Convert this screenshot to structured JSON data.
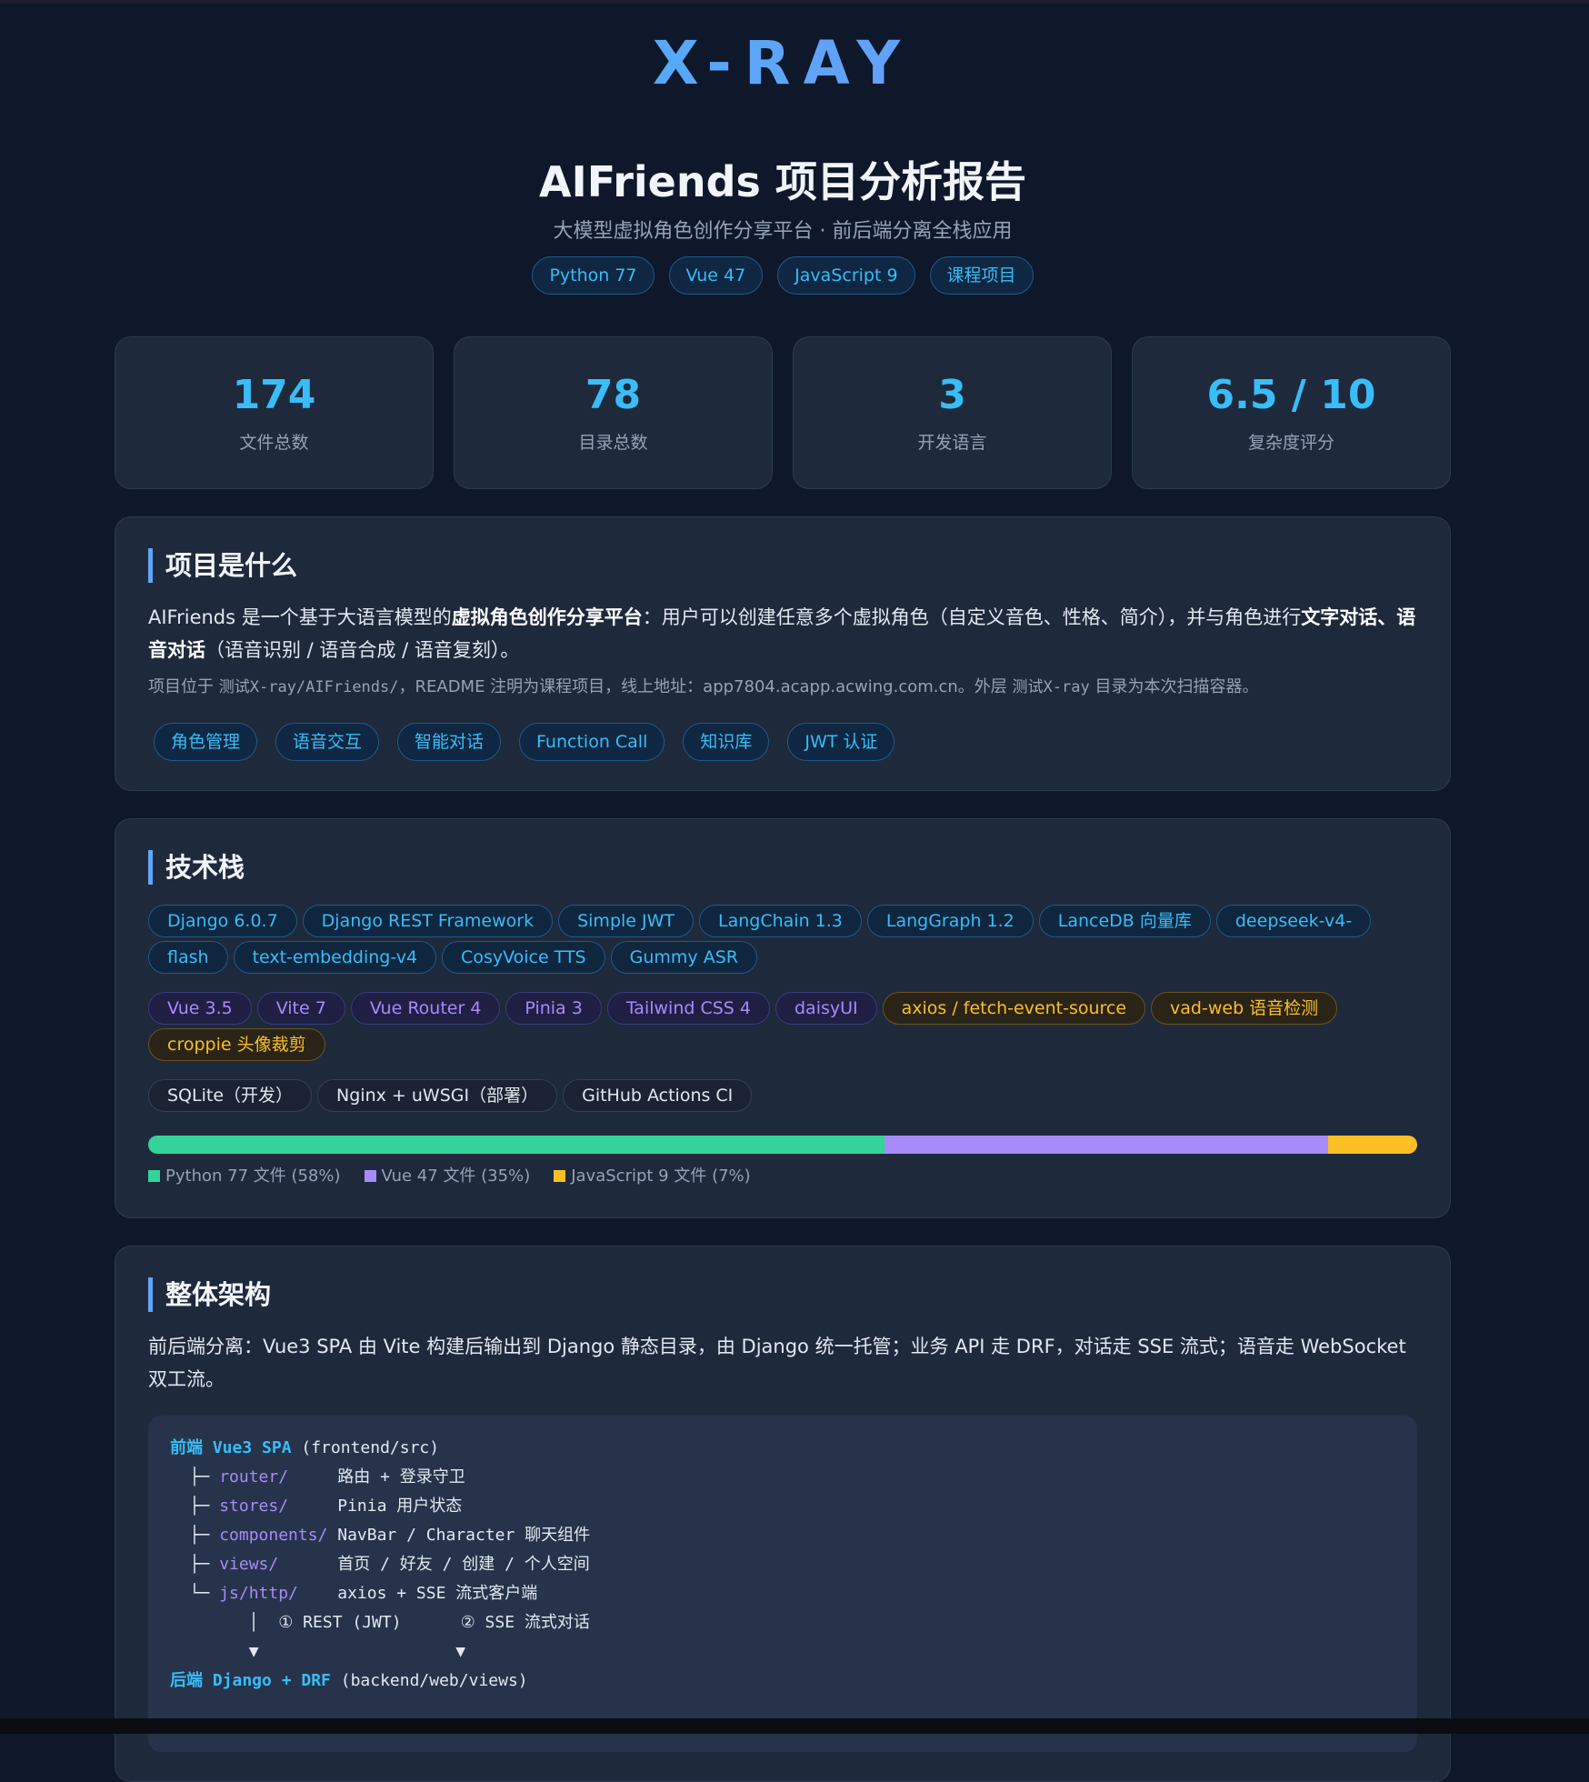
{
  "brand": "X-RAY",
  "report_title": "AIFriends 项目分析报告",
  "subtitle": "大模型虚拟角色创作分享平台 · 前后端分离全栈应用",
  "lang_tags": [
    "Python 77",
    "Vue 47",
    "JavaScript 9",
    "课程项目"
  ],
  "stats": [
    {
      "value": "174",
      "label": "文件总数"
    },
    {
      "value": "78",
      "label": "目录总数"
    },
    {
      "value": "3",
      "label": "开发语言"
    },
    {
      "value": "6.5 / 10",
      "label": "复杂度评分"
    }
  ],
  "about": {
    "heading": "项目是什么",
    "lead_parts": [
      {
        "text": "AIFriends 是一个基于大语言模型的",
        "bold": false
      },
      {
        "text": "虚拟角色创作分享平台",
        "bold": true
      },
      {
        "text": "：用户可以创建任意多个虚拟角色（自定义音色、性格、简介），并与角色进行",
        "bold": false
      },
      {
        "text": "文字对话、语音对话",
        "bold": true
      },
      {
        "text": "（语音识别 / 语音合成 / 语音复刻）。",
        "bold": false
      }
    ],
    "note_parts": [
      {
        "text": "项目位于 ",
        "code": false
      },
      {
        "text": "测试X-ray/AIFriends/",
        "code": true
      },
      {
        "text": "，README 注明为课程项目，线上地址：app7804.acapp.acwing.com.cn。外层 ",
        "code": false
      },
      {
        "text": "测试X-ray",
        "code": true
      },
      {
        "text": " 目录为本次扫描容器。",
        "code": false
      }
    ],
    "features": [
      "角色管理",
      "语音交互",
      "智能对话",
      "Function Call",
      "知识库",
      "JWT 认证"
    ]
  },
  "stack": {
    "heading": "技术栈",
    "rows": [
      [
        {
          "label": "Django 6.0.7",
          "tone": "blue"
        },
        {
          "label": "Django REST Framework",
          "tone": "blue"
        },
        {
          "label": "Simple JWT",
          "tone": "blue"
        },
        {
          "label": "LangChain 1.3",
          "tone": "blue"
        },
        {
          "label": "LangGraph 1.2",
          "tone": "blue"
        },
        {
          "label": "LanceDB 向量库",
          "tone": "blue"
        },
        {
          "label": "deepseek-v4-flash",
          "tone": "blue"
        },
        {
          "label": "text-embedding-v4",
          "tone": "blue"
        },
        {
          "label": "CosyVoice TTS",
          "tone": "blue"
        },
        {
          "label": "Gummy ASR",
          "tone": "blue"
        }
      ],
      [
        {
          "label": "Vue 3.5",
          "tone": "purple"
        },
        {
          "label": "Vite 7",
          "tone": "purple"
        },
        {
          "label": "Vue Router 4",
          "tone": "purple"
        },
        {
          "label": "Pinia 3",
          "tone": "purple"
        },
        {
          "label": "Tailwind CSS 4",
          "tone": "purple"
        },
        {
          "label": "daisyUI",
          "tone": "purple"
        },
        {
          "label": "axios / fetch-event-source",
          "tone": "yellow"
        },
        {
          "label": "vad-web 语音检测",
          "tone": "yellow"
        },
        {
          "label": "croppie 头像裁剪",
          "tone": "yellow"
        }
      ],
      [
        {
          "label": "SQLite（开发）",
          "tone": "gray"
        },
        {
          "label": "Nginx + uWSGI（部署）",
          "tone": "gray"
        },
        {
          "label": "GitHub Actions CI",
          "tone": "gray"
        }
      ]
    ],
    "languages": [
      {
        "name": "Python 77 文件 (58%)",
        "share": 58,
        "color": "#34d399"
      },
      {
        "name": "Vue 47 文件 (35%)",
        "share": 35,
        "color": "#a78bfa"
      },
      {
        "name": "JavaScript 9 文件 (7%)",
        "share": 7,
        "color": "#fbbf24"
      }
    ]
  },
  "arch": {
    "heading": "整体架构",
    "lead": "前后端分离：Vue3 SPA 由 Vite 构建后输出到 Django 静态目录，由 Django 统一托管；业务 API 走 DRF，对话走 SSE 流式；语音走 WebSocket 双工流。",
    "tree": [
      [
        {
          "t": "前端 Vue3 SPA",
          "c": "kw"
        },
        {
          "t": " (frontend/src)",
          "c": ""
        }
      ],
      [
        {
          "t": "  ├─ ",
          "c": ""
        },
        {
          "t": "router/",
          "c": "path"
        },
        {
          "t": "     路由 + 登录守卫",
          "c": ""
        }
      ],
      [
        {
          "t": "  ├─ ",
          "c": ""
        },
        {
          "t": "stores/",
          "c": "path"
        },
        {
          "t": "     Pinia 用户状态",
          "c": ""
        }
      ],
      [
        {
          "t": "  ├─ ",
          "c": ""
        },
        {
          "t": "components/",
          "c": "path"
        },
        {
          "t": " NavBar / Character 聊天组件",
          "c": ""
        }
      ],
      [
        {
          "t": "  ├─ ",
          "c": ""
        },
        {
          "t": "views/",
          "c": "path"
        },
        {
          "t": "      首页 / 好友 / 创建 / 个人空间",
          "c": ""
        }
      ],
      [
        {
          "t": "  └─ ",
          "c": ""
        },
        {
          "t": "js/http/",
          "c": "path"
        },
        {
          "t": "    axios + SSE 流式客户端",
          "c": ""
        }
      ],
      [
        {
          "t": "        │  ① REST (JWT)      ② SSE 流式对话",
          "c": ""
        }
      ],
      [
        {
          "t": "        ▼                    ▼",
          "c": ""
        }
      ],
      [
        {
          "t": "后端 Django + DRF",
          "c": "kw"
        },
        {
          "t": " (backend/web/views)",
          "c": ""
        }
      ]
    ]
  }
}
